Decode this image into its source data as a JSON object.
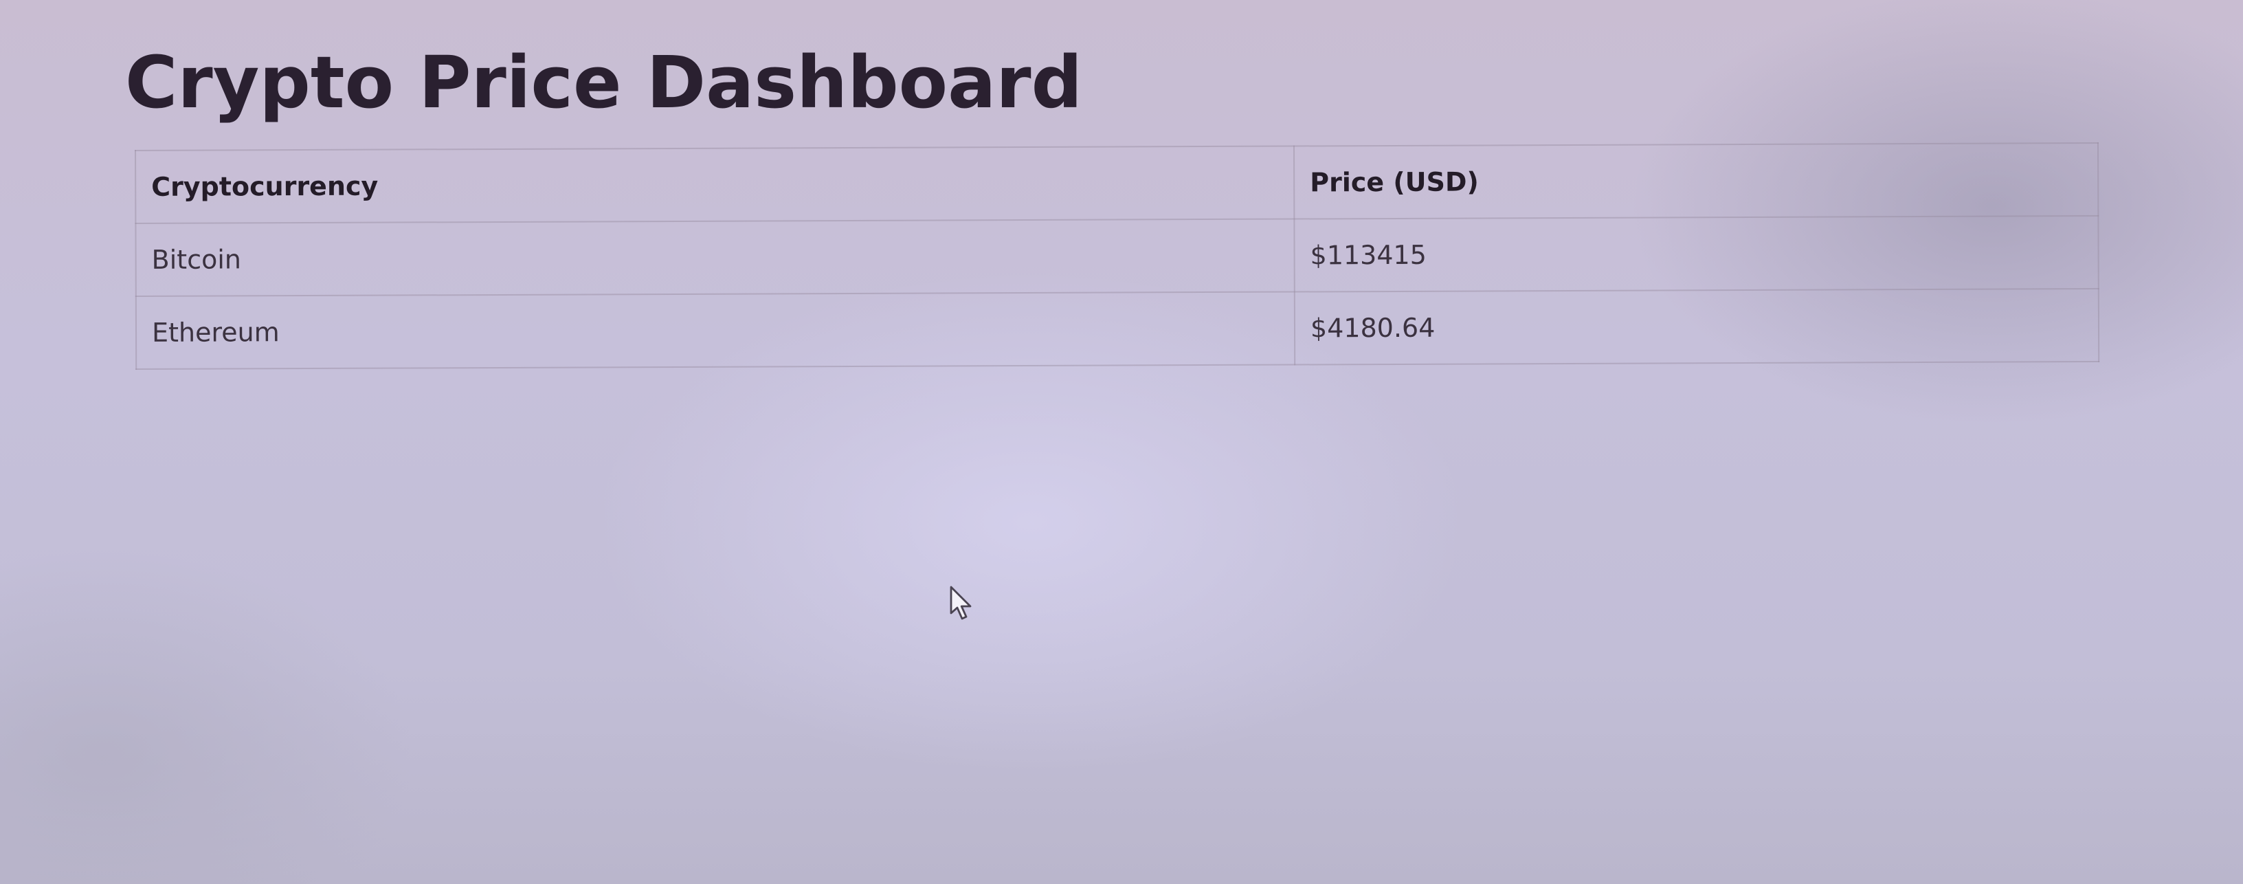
{
  "page": {
    "title": "Crypto Price Dashboard"
  },
  "table": {
    "headers": [
      "Cryptocurrency",
      "Price (USD)"
    ],
    "rows": [
      {
        "name": "Bitcoin",
        "price": "$113415"
      },
      {
        "name": "Ethereum",
        "price": "$4180.64"
      }
    ]
  },
  "cursor": {
    "icon": "mouse-pointer-icon"
  }
}
